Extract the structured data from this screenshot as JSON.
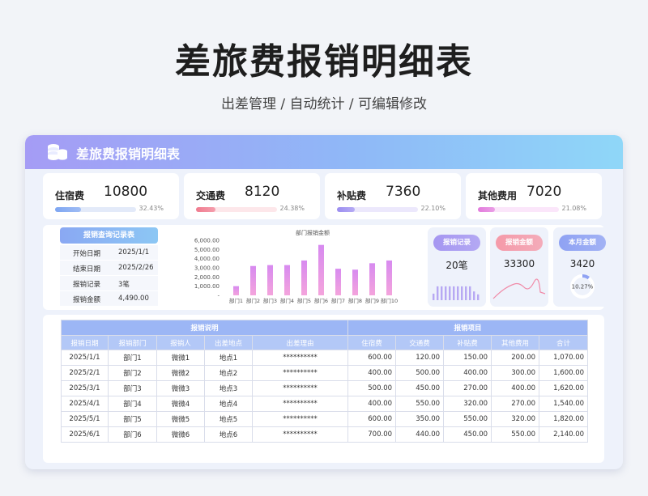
{
  "page": {
    "title": "差旅费报销明细表",
    "subtitle": "出差管理 /  自动统计  /  可编辑修改"
  },
  "banner": {
    "title": "差旅费报销明细表",
    "icon": "coin-stack-icon"
  },
  "kpis": [
    {
      "label": "住宿费",
      "value": "10800",
      "pct": "32.43%",
      "fraction": 0.3243,
      "color": "#7ea6f2",
      "track": "#e3eaf9"
    },
    {
      "label": "交通费",
      "value": "8120",
      "pct": "24.38%",
      "fraction": 0.2438,
      "color": "#f07a8e",
      "track": "#fde7ea"
    },
    {
      "label": "补贴费",
      "value": "7360",
      "pct": "22.10%",
      "fraction": 0.221,
      "color": "#9b8df0",
      "track": "#ece8fc"
    },
    {
      "label": "其他费用",
      "value": "7020",
      "pct": "21.08%",
      "fraction": 0.2108,
      "color": "#e27bdc",
      "track": "#fbe6fa"
    }
  ],
  "query": {
    "title": "报销查询记录表",
    "rows": [
      {
        "key": "开始日期",
        "value": "2025/1/1"
      },
      {
        "key": "结束日期",
        "value": "2025/2/26"
      },
      {
        "key": "报销记录",
        "value": "3笔"
      },
      {
        "key": "报销金额",
        "value": "4,490.00"
      }
    ]
  },
  "chart_data": {
    "type": "bar",
    "title": "部门报销金额",
    "categories": [
      "部门1",
      "部门2",
      "部门3",
      "部门4",
      "部门5",
      "部门6",
      "部门7",
      "部门8",
      "部门9",
      "部门10"
    ],
    "values": [
      1000,
      3200,
      3300,
      3300,
      3800,
      5500,
      2900,
      2800,
      3500,
      3800
    ],
    "yticks": [
      "6,000.00",
      "5,000.00",
      "4,000.00",
      "3,000.00",
      "2,000.00",
      "1,000.00",
      "-"
    ],
    "ylim": [
      0,
      6000
    ],
    "xlabel": "",
    "ylabel": ""
  },
  "stats": [
    {
      "label": "报销记录",
      "value": "20笔",
      "color": "#a596f1",
      "bars": [
        0.45,
        0.95,
        0.95,
        0.95,
        0.95,
        0.95,
        0.95,
        0.95,
        0.95,
        0.95,
        0.6,
        0.4
      ]
    },
    {
      "label": "报销金额",
      "value": "33300",
      "color": "#f59aa9"
    },
    {
      "label": "本月金额",
      "value": "3420",
      "pct": "10.27%",
      "fraction": 0.1027,
      "color": "#8fa2f3"
    }
  ],
  "table": {
    "group_left": "报销说明",
    "group_right": "报销项目",
    "columns": [
      "报销日期",
      "报销部门",
      "报销人",
      "出差地点",
      "出差理由",
      "住宿费",
      "交通费",
      "补贴费",
      "其他费用",
      "合计"
    ],
    "rows": [
      [
        "2025/1/1",
        "部门1",
        "微微1",
        "地点1",
        "**********",
        "600.00",
        "120.00",
        "150.00",
        "200.00",
        "1,070.00"
      ],
      [
        "2025/2/1",
        "部门2",
        "微微2",
        "地点2",
        "**********",
        "400.00",
        "500.00",
        "400.00",
        "300.00",
        "1,600.00"
      ],
      [
        "2025/3/1",
        "部门3",
        "微微3",
        "地点3",
        "**********",
        "500.00",
        "450.00",
        "270.00",
        "400.00",
        "1,620.00"
      ],
      [
        "2025/4/1",
        "部门4",
        "微微4",
        "地点4",
        "**********",
        "400.00",
        "550.00",
        "320.00",
        "270.00",
        "1,540.00"
      ],
      [
        "2025/5/1",
        "部门5",
        "微微5",
        "地点5",
        "**********",
        "600.00",
        "350.00",
        "550.00",
        "320.00",
        "1,820.00"
      ],
      [
        "2025/6/1",
        "部门6",
        "微微6",
        "地点6",
        "**********",
        "700.00",
        "440.00",
        "450.00",
        "550.00",
        "2,140.00"
      ]
    ]
  }
}
